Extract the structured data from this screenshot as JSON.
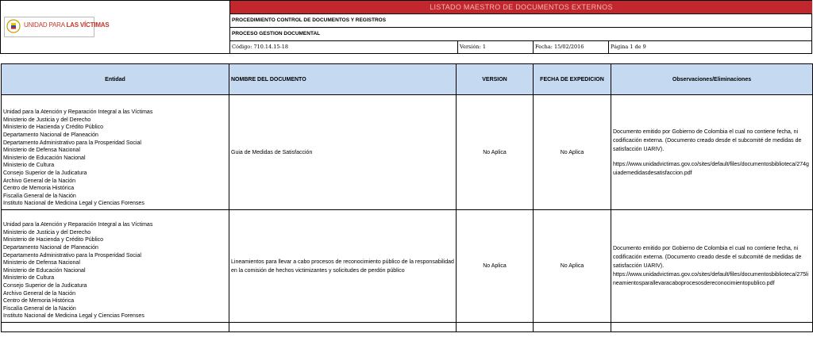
{
  "header": {
    "logo_text_light": "UNIDAD PARA ",
    "logo_text_bold": "LAS VÍCTIMAS",
    "title": "LISTADO MAESTRO DE DOCUMENTOS EXTERNOS",
    "procedure": "PROCEDIMIENTO CONTROL DE DOCUMENTOS Y REGISTROS",
    "process": "PROCESO GESTION DOCUMENTAL",
    "code": "Código: 710.14.15-18",
    "version": "Versión: 1",
    "date": "Fecha: 15/02/2016",
    "page": "Página 1 de 9"
  },
  "table": {
    "columns": [
      "Entidad",
      "NOMBRE DEL DOCUMENTO",
      "VERSION",
      "FECHA DE EXPEDICION",
      "Observaciones/Eliminaciones"
    ],
    "rows": [
      {
        "entities": [
          "Unidad para la Atención y Reparación Integral a las Víctimas",
          "Ministerio de Justicia y del Derecho",
          "Ministerio de Hacienda y Crédito Público",
          "Departamento Nacional de Planeación",
          "Departamento Administrativo para la Prosperidad Social",
          "Ministerio de Defensa Nacional",
          "Ministerio de Educación Nacional",
          "Ministerio de Cultura",
          "Consejo Superior de la Judicatura",
          "Archivo General de la Nación",
          "Centro de Memoria Histórica",
          "Fiscalía General de la Nación",
          "Instituto Nacional de Medicina Legal y Ciencias Forenses"
        ],
        "document": "Guia de Medidas de Satisfacción",
        "version": "No Aplica",
        "date": "No Aplica",
        "obs": "Documento emitido por Gobierno de Colombia el cual no contiene fecha, ni codificación externa. (Documento creado desde el subcomité de medidas de satisfacción UARIV).",
        "obs_url": "https://www.unidadvictimas.gov.co/sites/default/files/documentosbiblioteca/274guiademedidasdesatisfaccion.pdf"
      },
      {
        "entities": [
          "Unidad para la Atención y Reparación Integral a las Víctimas",
          "Ministerio de Justicia y del Derecho",
          "Ministerio de Hacienda y Crédito Público",
          "Departamento Nacional de Planeación",
          "Departamento Administrativo para la Prosperidad Social",
          "Ministerio de Defensa Nacional",
          "Ministerio de Educación Nacional",
          "Ministerio de Cultura",
          "Consejo Superior de la Judicatura",
          "Archivo General de la Nación",
          "Centro de Memoria Histórica",
          "Fiscalía General de la Nación",
          "Instituto Nacional de Medicina Legal y Ciencias Forenses"
        ],
        "document": "Lineamientos para llevar a cabo procesos de reconocimiento público de la responsabilidad en la comisión de hechos victimizantes y solicitudes de perdón público",
        "version": "No Aplica",
        "date": "No Aplica",
        "obs": "Documento emitido por Gobierno de Colombia el cual no contiene fecha, ni codificación externa. (Documento creado desde el subcomité de medidas de satisfacción UARIV).",
        "obs_url": "https://www.unidadvictimas.gov.co/sites/default/files/documentosbiblioteca/275lineamientosparallevaracaboprocesosdereconocimientopublico.pdf"
      }
    ]
  }
}
